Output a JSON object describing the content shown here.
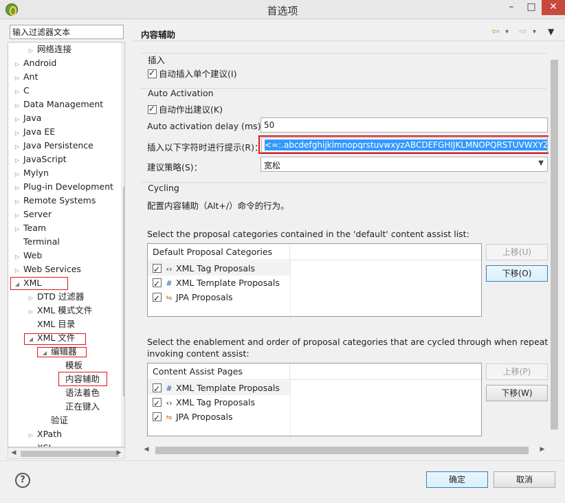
{
  "window": {
    "title": "首选项",
    "min_glyph": "–",
    "max_glyph": "□",
    "close_glyph": "✕"
  },
  "filter": {
    "placeholder": "输入过滤器文本"
  },
  "tree": [
    {
      "label": "网络连接",
      "level": 2,
      "arrow": "right"
    },
    {
      "label": "Android",
      "level": 1,
      "arrow": "right"
    },
    {
      "label": "Ant",
      "level": 1,
      "arrow": "right"
    },
    {
      "label": "C",
      "level": 1,
      "arrow": "right"
    },
    {
      "label": "Data Management",
      "level": 1,
      "arrow": "right"
    },
    {
      "label": "Java",
      "level": 1,
      "arrow": "right"
    },
    {
      "label": "Java EE",
      "level": 1,
      "arrow": "right"
    },
    {
      "label": "Java Persistence",
      "level": 1,
      "arrow": "right"
    },
    {
      "label": "JavaScript",
      "level": 1,
      "arrow": "right"
    },
    {
      "label": "Mylyn",
      "level": 1,
      "arrow": "right"
    },
    {
      "label": "Plug-in Development",
      "level": 1,
      "arrow": "right"
    },
    {
      "label": "Remote Systems",
      "level": 1,
      "arrow": "right"
    },
    {
      "label": "Server",
      "level": 1,
      "arrow": "right"
    },
    {
      "label": "Team",
      "level": 1,
      "arrow": "right"
    },
    {
      "label": "Terminal",
      "level": 1,
      "arrow": "none"
    },
    {
      "label": "Web",
      "level": 1,
      "arrow": "right"
    },
    {
      "label": "Web Services",
      "level": 1,
      "arrow": "right"
    },
    {
      "label": "XML",
      "level": 1,
      "arrow": "down"
    },
    {
      "label": "DTD 过滤器",
      "level": 2,
      "arrow": "right"
    },
    {
      "label": "XML 模式文件",
      "level": 2,
      "arrow": "right"
    },
    {
      "label": "XML 目录",
      "level": 2,
      "arrow": "none"
    },
    {
      "label": "XML 文件",
      "level": 2,
      "arrow": "down"
    },
    {
      "label": "编辑器",
      "level": 3,
      "arrow": "down"
    },
    {
      "label": "模板",
      "level": 4,
      "arrow": "none"
    },
    {
      "label": "内容辅助",
      "level": 4,
      "arrow": "none"
    },
    {
      "label": "语法着色",
      "level": 4,
      "arrow": "none"
    },
    {
      "label": "正在键入",
      "level": 4,
      "arrow": "none"
    },
    {
      "label": "验证",
      "level": 3,
      "arrow": "none"
    },
    {
      "label": "XPath",
      "level": 2,
      "arrow": "right"
    },
    {
      "label": "XSL",
      "level": 2,
      "arrow": "right"
    }
  ],
  "page": {
    "title": "内容辅助",
    "back_glyph": "⇦",
    "forward_glyph": "⇨",
    "menu_glyph": "▾"
  },
  "insert_group": {
    "title": "插入",
    "auto_insert_label": "自动插入单个建议(I)",
    "auto_insert_checked": true
  },
  "activation_group": {
    "title": "Auto Activation",
    "auto_propose_label": "自动作出建议(K)",
    "auto_propose_checked": true,
    "delay_label": "Auto activation delay (ms):",
    "delay_value": "50",
    "trigger_label": "插入以下字符时进行提示(R)：",
    "trigger_value": "<=:.abcdefghijklmnopqrstuvwxyzABCDEFGHIJKLMNOPQRSTUVWXYZ(",
    "strategy_label": "建议策略(S)：",
    "strategy_value": "宽松"
  },
  "cycling": {
    "title": "Cycling",
    "description": "配置内容辅助（Alt+/）命令的行为。",
    "default_list_label": "Select the proposal categories contained in the 'default' content assist list:",
    "default_table_header": "Default Proposal Categories",
    "default_rows": [
      {
        "icon": "‹›",
        "icon_name": "xml-tag-icon",
        "label": "XML Tag Proposals",
        "checked": true
      },
      {
        "icon": "#",
        "icon_name": "xml-template-icon",
        "label": "XML Template Proposals",
        "checked": true
      },
      {
        "icon": "⇋",
        "icon_name": "jpa-icon",
        "label": "JPA Proposals",
        "checked": true
      }
    ],
    "up_label": "上移(U)",
    "down_label": "下移(O)",
    "pages_label_1": "Select the enablement and order of proposal categories that are cycled through when repeatedly",
    "pages_label_2": "invoking content assist:",
    "pages_table_header": "Content Assist Pages",
    "pages_rows": [
      {
        "icon": "#",
        "icon_name": "xml-template-icon",
        "label": "XML Template Proposals",
        "checked": true
      },
      {
        "icon": "‹›",
        "icon_name": "xml-tag-icon",
        "label": "XML Tag Proposals",
        "checked": true
      },
      {
        "icon": "⇋",
        "icon_name": "jpa-icon",
        "label": "JPA Proposals",
        "checked": true
      }
    ],
    "up2_label": "上移(P)",
    "down2_label": "下移(W)"
  },
  "footer": {
    "help_glyph": "?",
    "ok_label": "确定",
    "cancel_label": "取消"
  },
  "colors": {
    "accent": "#3399ff",
    "highlight_border": "#e0141b",
    "close_button": "#c9483c"
  }
}
